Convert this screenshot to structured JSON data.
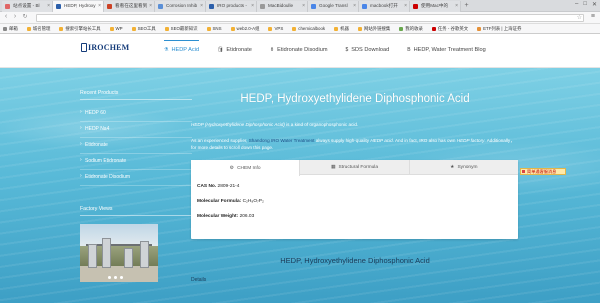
{
  "tabs": [
    {
      "label": "站点设置 - Bl",
      "color": "#e06666",
      "active": false
    },
    {
      "label": "HEDP, Hydroxy",
      "color": "#2c5faa",
      "active": true
    },
    {
      "label": "看看在这里看到",
      "color": "#cc4125",
      "active": false
    },
    {
      "label": "Corrosion Inhib",
      "color": "#5b8fd6",
      "active": false
    },
    {
      "label": "IRO products - ",
      "color": "#2c5faa",
      "active": false
    },
    {
      "label": "MacBidoulle",
      "color": "#999999",
      "active": false
    },
    {
      "label": "Google Transl",
      "color": "#4a86e8",
      "active": false
    },
    {
      "label": "macbook打开",
      "color": "#4a86e8",
      "active": false
    },
    {
      "label": "使用Mac中的",
      "color": "#cc0000",
      "active": false
    }
  ],
  "window_controls": [
    "–",
    "□",
    "✕"
  ],
  "address_bar": {
    "url": "",
    "nav_back": "‹",
    "nav_forward": "›",
    "reload": "↻",
    "star": "☆",
    "menu": "≡"
  },
  "bookmarks": [
    {
      "label": "邮箱",
      "color": "#888888"
    },
    {
      "label": "城名管理",
      "color": "#f2b135"
    },
    {
      "label": "搜索引擎站长工具",
      "color": "#f2b135"
    },
    {
      "label": "WP",
      "color": "#f2b135"
    },
    {
      "label": "SEO工具",
      "color": "#f2b135"
    },
    {
      "label": "SEO最新知识",
      "color": "#f2b135"
    },
    {
      "label": "SNS",
      "color": "#f2b135"
    },
    {
      "label": "web2.0-A组",
      "color": "#f2b135"
    },
    {
      "label": "VPS",
      "color": "#f2b135"
    },
    {
      "label": "chemicalbook",
      "color": "#f2b135"
    },
    {
      "label": "机器",
      "color": "#f2b135"
    },
    {
      "label": "网站外链搜集",
      "color": "#f2b135"
    },
    {
      "label": "我的收录",
      "color": "#6aa84f"
    },
    {
      "label": "任务 - 谷歌英文",
      "color": "#cc0000"
    },
    {
      "label": "ETF列表 | 上海证券",
      "color": "#e69138"
    }
  ],
  "site": {
    "logo_text": "IROCHEM",
    "nav": [
      {
        "label": "HEDP Acid",
        "icon": "flask-icon",
        "glyph": "⚗",
        "active": true
      },
      {
        "label": "Etidronate",
        "icon": "bottle-icon",
        "glyph": "🛢",
        "active": false
      },
      {
        "label": "Etidronate Disodium",
        "icon": "beaker-icon",
        "glyph": "⚱",
        "active": false
      },
      {
        "label": "SDS Download",
        "icon": "dollar-icon",
        "glyph": "$",
        "active": false
      },
      {
        "label": "HEDP, Water Treatment Blog",
        "icon": "b-icon",
        "glyph": "B",
        "active": false
      }
    ]
  },
  "sidebar": {
    "recent_products_title": "Recent Products",
    "products": [
      "HEDP 60",
      "HEDP Na4",
      "Etidronate",
      "Sodium Etidronate",
      "Etidronate Disodium"
    ],
    "factory_title": "Factory Views"
  },
  "main": {
    "title": "HEDP, Hydroxyethylidene Diphosphonic Acid",
    "intro_italic": "HEDP (Hydroxyethylidene Diphosphonic Acid)",
    "intro_rest": " is a kind of organophosphonic acid.",
    "intro2_a": "As an experienced supplier, ",
    "intro2_link": "Shandong IRO Water Treatment",
    "intro2_b": " always supply high-quality ",
    "intro2_c": "HEDP acid",
    "intro2_d": ". And in fact, IRO also has own ",
    "intro2_e": "HEDP factory",
    "intro2_f": ". Additionally，  for more details to scroll down this page.",
    "info_tabs": [
      {
        "label": "CHEM Info",
        "icon": "gear-icon",
        "glyph": "⚙",
        "active": true
      },
      {
        "label": "Structural Formula",
        "icon": "structure-icon",
        "glyph": "▦",
        "active": false
      },
      {
        "label": "Synonym",
        "icon": "star-icon",
        "glyph": "★",
        "active": false
      }
    ],
    "props": [
      {
        "key": "CAS No.",
        "value": "2809-21-4"
      },
      {
        "key": "Molecular Formula:",
        "value": "C₂H₈O₇P₂"
      },
      {
        "key": "Molecular Weight:",
        "value": "206.03"
      }
    ],
    "subtitle": "HEDP, Hydroxyethylidene Diphosphonic Acid",
    "details_label": "Details"
  },
  "widget_label": "简单通客服消息"
}
